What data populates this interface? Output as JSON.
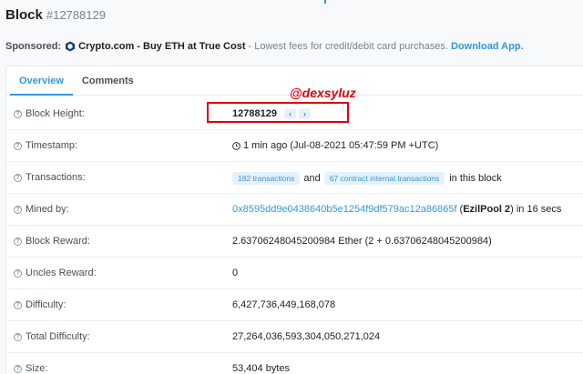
{
  "header": {
    "title": "Block",
    "block_ref": "#12788129"
  },
  "sponsor": {
    "label": "Sponsored:",
    "brand": "Crypto.com - Buy ETH at True Cost",
    "desc": "- Lowest fees for credit/debit card purchases.",
    "cta": "Download App."
  },
  "tabs": {
    "overview": "Overview",
    "comments": "Comments"
  },
  "annotation": {
    "text": "@dexsyluz",
    "color": "#e0000e"
  },
  "rows": {
    "height": {
      "label": "Block Height:",
      "value": "12788129",
      "prev": "‹",
      "next": "›"
    },
    "timestamp": {
      "label": "Timestamp:",
      "value": "1 min ago (Jul-08-2021 05:47:59 PM +UTC)"
    },
    "transactions": {
      "label": "Transactions:",
      "tx_badge": "182 transactions",
      "and": "and",
      "internal_badge": "67 contract internal transactions",
      "suffix": "in this block"
    },
    "mined": {
      "label": "Mined by:",
      "address": "0x8595dd9e0438640b5e1254f9df579ac12a86865f",
      "pool": "EzilPool 2",
      "suffix": "in 16 secs"
    },
    "reward": {
      "label": "Block Reward:",
      "value": "2.63706248045200984 Ether (2 + 0.63706248045200984)"
    },
    "uncles": {
      "label": "Uncles Reward:",
      "value": "0"
    },
    "difficulty": {
      "label": "Difficulty:",
      "value": "6,427,736,449,168,078"
    },
    "total_difficulty": {
      "label": "Total Difficulty:",
      "value": "27,264,036,593,304,050,271,024"
    },
    "size": {
      "label": "Size:",
      "value": "53,404 bytes"
    }
  },
  "colors": {
    "accent": "#3498db",
    "annotation": "#e0000e"
  }
}
